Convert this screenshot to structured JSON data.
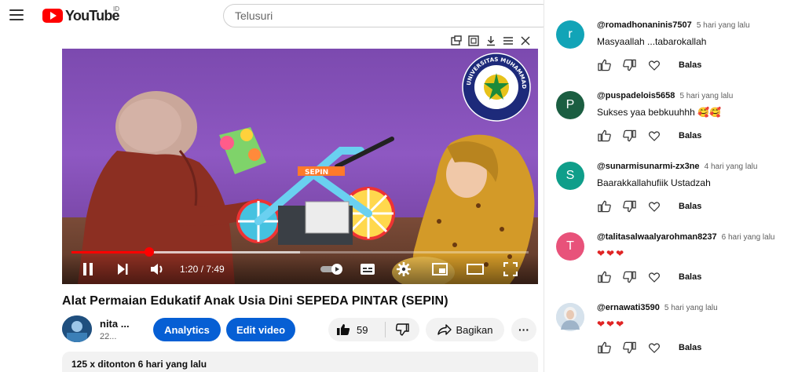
{
  "masthead": {
    "logo_text": "YouTube",
    "region": "ID",
    "search_placeholder": "Telusuri"
  },
  "player": {
    "current_time": "1:20",
    "duration": "7:49",
    "time_display": "1:20 / 7:49",
    "progress_fraction": 0.17,
    "buffer_fraction": 0.5,
    "seal_top_text": "UNIVERSITAS MUHAMMADIYAH",
    "seal_bottom_text": "PONOROGO",
    "bike_label": "SEPIN"
  },
  "video": {
    "title": "Alat Permaian Edukatif Anak Usia Dini SEPEDA PINTAR (SEPIN)",
    "channel_name": "nita ...",
    "channel_subs": "22...",
    "analytics_label": "Analytics",
    "edit_label": "Edit video",
    "like_count": "59",
    "share_label": "Bagikan",
    "more_label": "···",
    "views_and_date": "125 x ditonton  6 hari yang lalu"
  },
  "comments": [
    {
      "avatar_letter": "r",
      "avatar_color": "#12a4b7",
      "user": "@romadhonaninis7507",
      "time": "5 hari yang lalu",
      "text": "Masyaallah ...tabarokallah",
      "reply_label": "Balas"
    },
    {
      "avatar_letter": "P",
      "avatar_color": "#1b5e41",
      "user": "@puspadelois5658",
      "time": "5 hari yang lalu",
      "text": "Sukses yaa bebkuuhhh 🥰🥰",
      "reply_label": "Balas"
    },
    {
      "avatar_letter": "S",
      "avatar_color": "#0f9e8a",
      "user": "@sunarmisunarmi-zx3ne",
      "time": "4 hari yang lalu",
      "text": "Baarakkallahufiik Ustadzah",
      "reply_label": "Balas"
    },
    {
      "avatar_letter": "T",
      "avatar_color": "#e8527a",
      "user": "@talitasalwaalyarohman8237",
      "time": "6 hari yang lalu",
      "text": "❤❤❤",
      "reply_label": "Balas"
    },
    {
      "avatar_letter": "",
      "avatar_color": "#c9d8e6",
      "user": "@ernawati3590",
      "time": "5 hari yang lalu",
      "text": "❤❤❤",
      "reply_label": "Balas"
    }
  ]
}
